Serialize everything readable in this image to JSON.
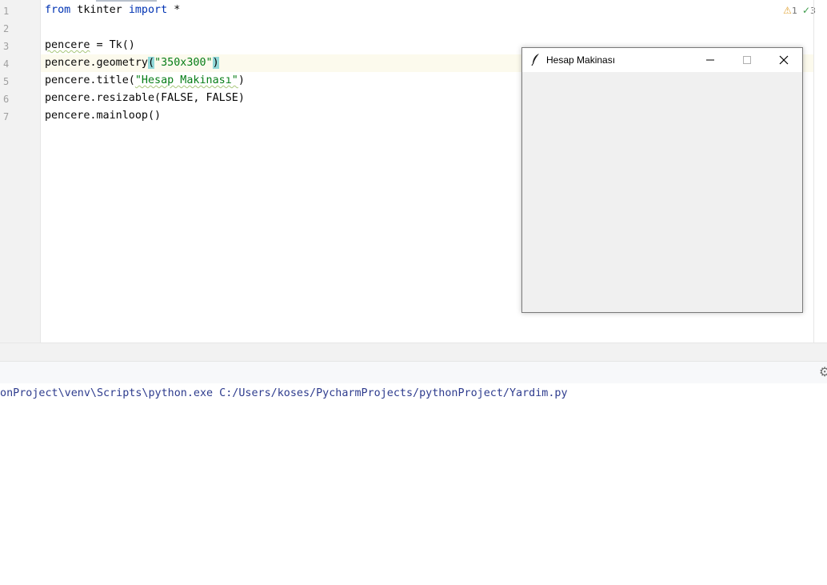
{
  "editor": {
    "line_numbers": [
      "1",
      "2",
      "3",
      "4",
      "5",
      "6",
      "7"
    ],
    "lines": {
      "l1": {
        "kw1": "from",
        "t1": " tkinter ",
        "kw2": "import",
        "t2": " *"
      },
      "l3": {
        "var": "pencere",
        "rest": " = Tk()"
      },
      "l4": {
        "var": "pencere",
        "call": ".geometry",
        "lp": "(",
        "str": "\"350x300\"",
        "rp": ")"
      },
      "l5": {
        "pre": "pencere.title(",
        "str": "\"Hesap Makinası\"",
        "post": ")"
      },
      "l6": {
        "text": "pencere.resizable(FALSE, FALSE)"
      },
      "l7": {
        "text": "pencere.mainloop()"
      }
    },
    "inspections": {
      "warnings": "1",
      "ok": "3"
    }
  },
  "tk_window": {
    "title": "Hesap Makinası",
    "icon": "feather-icon"
  },
  "console": {
    "command": "honProject\\venv\\Scripts\\python.exe C:/Users/koses/PycharmProjects/pythonProject/Yardim.py"
  },
  "colors": {
    "keyword": "#0033b3",
    "string": "#067d17",
    "console_text": "#2e3c8e",
    "caret_line": "#fcfaed",
    "brace_match": "#93d9d9"
  }
}
